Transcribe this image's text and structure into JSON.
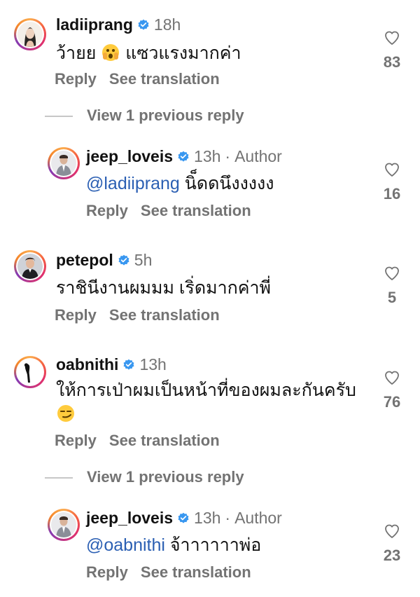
{
  "comments": [
    {
      "username": "ladiiprang",
      "time": "18h",
      "text_before_emoji": "ว้ายย ",
      "emoji": "shocked-face-emoji",
      "text_after_emoji": " แซวแรงมากค่า",
      "reply_label": "Reply",
      "translate_label": "See translation",
      "likes": "83",
      "view_replies": "View 1 previous reply"
    },
    {
      "username": "jeep_loveis",
      "time": "13h",
      "author_tag": "Author",
      "mention": "@ladiiprang",
      "text": " นิ็ดดนึงงงงง",
      "reply_label": "Reply",
      "translate_label": "See translation",
      "likes": "16"
    },
    {
      "username": "petepol",
      "time": "5h",
      "text": "ราชินีงานผมมม เริ่ดมากค่าพี่",
      "reply_label": "Reply",
      "translate_label": "See translation",
      "likes": "5"
    },
    {
      "username": "oabnithi",
      "time": "13h",
      "text": "ให้การเป่าผมเป็นหน้าที่ของผมละกันครับ",
      "emoji": "smirking-face-emoji",
      "reply_label": "Reply",
      "translate_label": "See translation",
      "likes": "76",
      "view_replies": "View 1 previous reply"
    },
    {
      "username": "jeep_loveis",
      "time": "13h",
      "author_tag": "Author",
      "mention": "@oabnithi",
      "text": " จ้าาาาาาพ่อ",
      "reply_label": "Reply",
      "translate_label": "See translation",
      "likes": "23"
    }
  ],
  "separator": "·",
  "colors": {
    "verified": "#3897f0",
    "mention": "#2b5fb3",
    "secondary_text": "#737373"
  }
}
